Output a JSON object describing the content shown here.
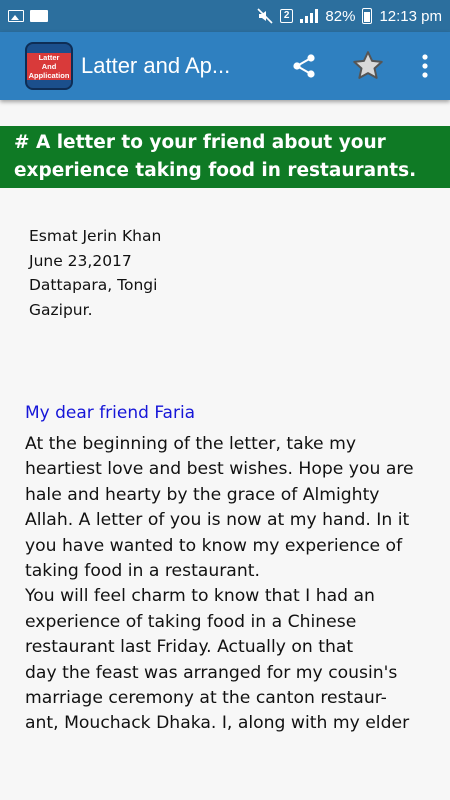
{
  "status_bar": {
    "notification_count": "2",
    "battery": "82%",
    "time": "12:13 pm"
  },
  "app_bar": {
    "logo_line1": "Latter",
    "logo_line2": "And",
    "logo_line3": "Application",
    "title": "Latter and Ap...",
    "icons": [
      "share-icon",
      "star-icon",
      "more-vert-icon"
    ]
  },
  "heading": {
    "line1": "# A letter to your friend about your",
    "line2": "experience taking food in restaurants."
  },
  "letter": {
    "address": [
      "Esmat Jerin Khan",
      "June 23,2017",
      "Dattapara, Tongi",
      "Gazipur."
    ],
    "salutation": "My dear friend Faria",
    "lines": [
      "At the beginning of the letter, take my",
      "heartiest love and best wishes. Hope you are",
      "hale and hearty by the grace of Almighty",
      "Allah. A letter of you is now at my hand. In it",
      "you have wanted to know my experience of",
      "taking food in a restaurant.",
      "You will feel charm to know that I had an",
      "experience of taking food in a Chinese",
      "restaurant last Friday. Actually on that",
      "day the feast was arranged for my cousin's",
      "marriage ceremony at the canton restaur-",
      "ant, Mouchack Dhaka. I, along with my elder"
    ]
  },
  "colors": {
    "status_bar": "#2c6f9e",
    "app_bar": "#2f80c0",
    "heading_bg": "#0f7a25",
    "salutation": "#1616d8"
  }
}
